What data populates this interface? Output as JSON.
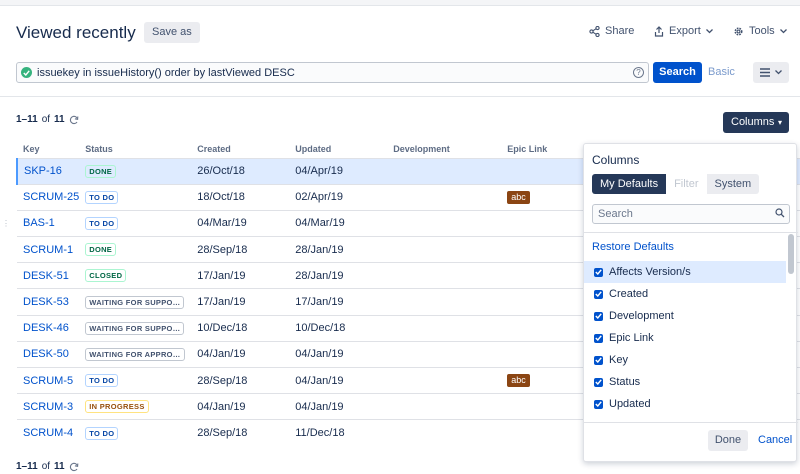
{
  "header": {
    "title": "Viewed recently",
    "save_as": "Save as",
    "share": "Share",
    "export": "Export",
    "tools": "Tools"
  },
  "search": {
    "jql": "issuekey in issueHistory() order by lastViewed DESC",
    "search_button": "Search",
    "basic_link": "Basic"
  },
  "pagination": {
    "range": "1–11",
    "of_word": "of",
    "total": "11"
  },
  "columns_button": "Columns",
  "table": {
    "headers": [
      "Key",
      "Status",
      "Created",
      "Updated",
      "Development",
      "Epic Link"
    ],
    "rows": [
      {
        "key": "SKP-16",
        "status": "DONE",
        "created": "26/Oct/18",
        "updated": "04/Apr/19",
        "epic": ""
      },
      {
        "key": "SCRUM-25",
        "status": "TO DO",
        "created": "18/Oct/18",
        "updated": "02/Apr/19",
        "epic": "abc"
      },
      {
        "key": "BAS-1",
        "status": "TO DO",
        "created": "04/Mar/19",
        "updated": "04/Mar/19",
        "epic": ""
      },
      {
        "key": "SCRUM-1",
        "status": "DONE",
        "created": "28/Sep/18",
        "updated": "28/Jan/19",
        "epic": ""
      },
      {
        "key": "DESK-51",
        "status": "CLOSED",
        "created": "17/Jan/19",
        "updated": "28/Jan/19",
        "epic": ""
      },
      {
        "key": "DESK-53",
        "status": "WAITING FOR SUPPO…",
        "created": "17/Jan/19",
        "updated": "17/Jan/19",
        "epic": ""
      },
      {
        "key": "DESK-46",
        "status": "WAITING FOR SUPPO…",
        "created": "10/Dec/18",
        "updated": "10/Dec/18",
        "epic": ""
      },
      {
        "key": "DESK-50",
        "status": "WAITING FOR APPRO…",
        "created": "04/Jan/19",
        "updated": "04/Jan/19",
        "epic": ""
      },
      {
        "key": "SCRUM-5",
        "status": "TO DO",
        "created": "28/Sep/18",
        "updated": "04/Jan/19",
        "epic": "abc"
      },
      {
        "key": "SCRUM-3",
        "status": "IN PROGRESS",
        "created": "04/Jan/19",
        "updated": "04/Jan/19",
        "epic": ""
      },
      {
        "key": "SCRUM-4",
        "status": "TO DO",
        "created": "28/Sep/18",
        "updated": "11/Dec/18",
        "epic": ""
      }
    ]
  },
  "columns_panel": {
    "title": "Columns",
    "tabs": [
      "My Defaults",
      "Filter",
      "System"
    ],
    "search_placeholder": "Search",
    "restore": "Restore Defaults",
    "items": [
      "Affects Version/s",
      "Created",
      "Development",
      "Epic Link",
      "Key",
      "Status",
      "Updated"
    ],
    "done": "Done",
    "cancel": "Cancel"
  },
  "colors": {
    "primary": "#0052cc",
    "dark": "#253858",
    "epic": "#8b4513"
  }
}
